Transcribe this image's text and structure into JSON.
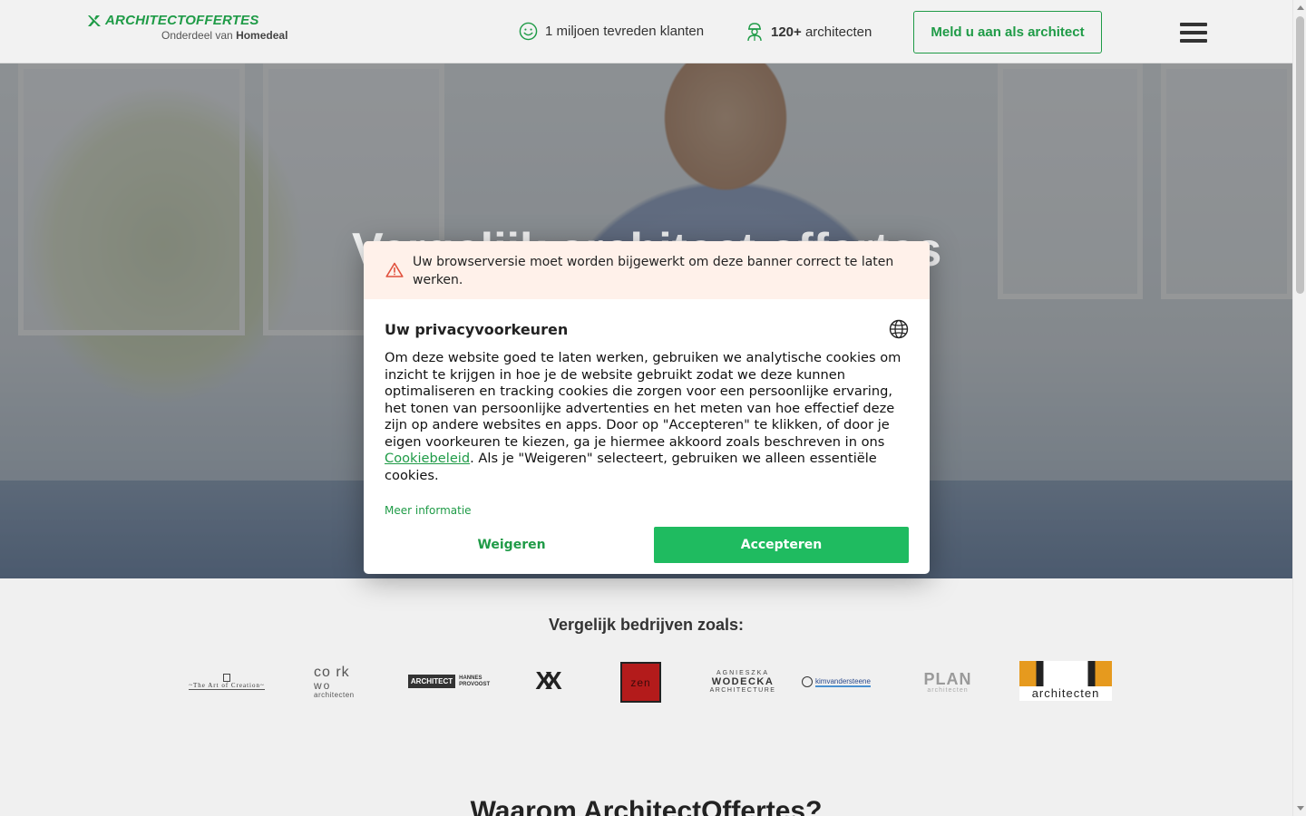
{
  "header": {
    "logo_text": "ARCHITECTOFFERTES",
    "logo_sub_prefix": "Onderdeel van ",
    "logo_sub_brand": "Homedeal",
    "stat1_text": "1 miljoen tevreden klanten",
    "stat2_bold": "120+",
    "stat2_text": " architecten",
    "cta_label": "Meld u aan als architect"
  },
  "hero": {
    "title": "Vergelijk architect offertes"
  },
  "companies": {
    "title": "Vergelijk bedrijven zoals:",
    "logos": [
      {
        "name": "The Art of Creation",
        "text": "~The Art of Creation~"
      },
      {
        "name": "Corkwo architecten",
        "text_top": "co rk",
        "text_mid": "wo",
        "text_bottom": "architecten"
      },
      {
        "name": "Architect Hannes Provoost",
        "text_a": "ARCHITECT",
        "text_b": "HANNES PROVOOST"
      },
      {
        "name": "XX",
        "text": "XX"
      },
      {
        "name": "Zen",
        "text": "zen"
      },
      {
        "name": "Agnieszka Wodecka",
        "line1": "AGNIESZKA",
        "line2": "WODECKA",
        "line3": "ARCHITECTURE"
      },
      {
        "name": "Kim Vanderstene",
        "text": "kimvandersteene"
      },
      {
        "name": "Plan",
        "text": "PLAN",
        "sub": "architecten"
      },
      {
        "name": "AT architecten",
        "text": "architecten"
      }
    ],
    "bottom_title": "Waarom ArchitectOffertes?"
  },
  "consent": {
    "warning": "Uw browserversie moet worden bijgewerkt om deze banner correct te laten werken.",
    "title": "Uw privacyvoorkeuren",
    "text_part1": "Om deze website goed te laten werken, gebruiken we analytische cookies om inzicht te krijgen in hoe je de website gebruikt zodat we deze kunnen optimaliseren en tracking cookies die zorgen voor een persoonlijke ervaring, het tonen van persoonlijke advertenties en het meten van hoe effectief deze zijn op andere websites en apps. Door op \"Accepteren\" te klikken, of door je eigen voorkeuren te kiezen, ga je hiermee akkoord zoals beschreven in ons ",
    "policy_link": "Cookiebeleid",
    "text_part2": ". Als je \"Weigeren\" selecteert, gebruiken we alleen essentiële cookies.",
    "more_info": "Meer informatie",
    "decline_label": "Weigeren",
    "accept_label": "Accepteren"
  },
  "colors": {
    "brand_green": "#1f9b47",
    "accept_green": "#1fbb60",
    "warning_bg": "#fff1ea",
    "warning_icon": "#e0503c"
  }
}
